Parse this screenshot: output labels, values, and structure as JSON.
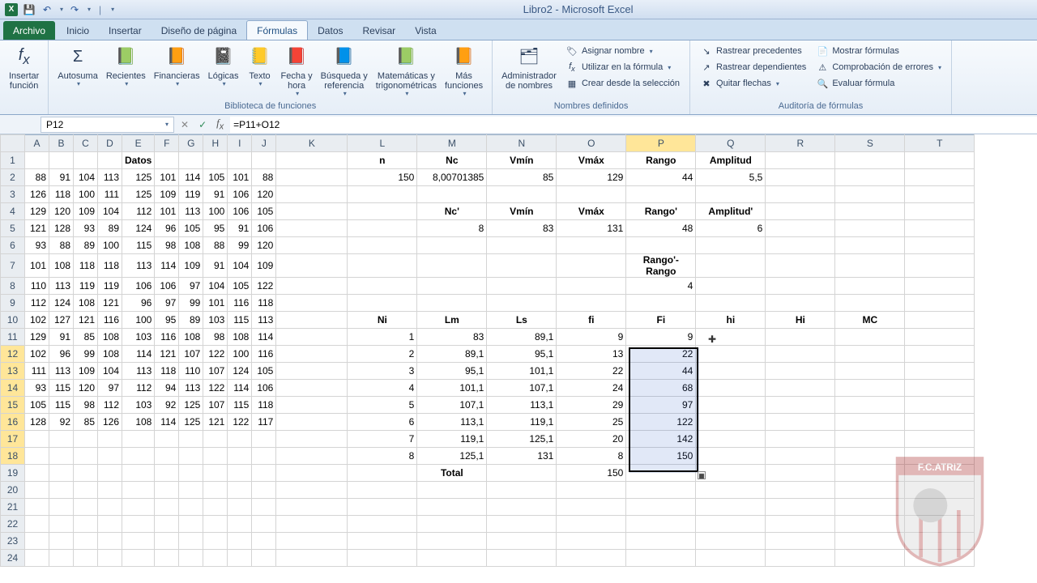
{
  "app": {
    "title": "Libro2  -  Microsoft Excel"
  },
  "qat": {
    "save": "💾",
    "undo": "↶",
    "redo": "↷"
  },
  "tabs": {
    "file": "Archivo",
    "inicio": "Inicio",
    "insertar": "Insertar",
    "diseno": "Diseño de página",
    "formulas": "Fórmulas",
    "datos": "Datos",
    "revisar": "Revisar",
    "vista": "Vista"
  },
  "ribbon": {
    "insertfn": "Insertar\nfunción",
    "autosuma": "Autosuma",
    "recientes": "Recientes",
    "financieras": "Financieras",
    "logicas": "Lógicas",
    "texto": "Texto",
    "fechahora": "Fecha y\nhora",
    "busqueda": "Búsqueda y\nreferencia",
    "mattrig": "Matemáticas y\ntrigonométricas",
    "mas": "Más\nfunciones",
    "biblioteca": "Biblioteca de funciones",
    "adminnombres": "Administrador\nde nombres",
    "asignarnombre": "Asignar nombre",
    "utilizarformula": "Utilizar en la fórmula",
    "creardesde": "Crear desde la selección",
    "nombresdef": "Nombres definidos",
    "rastrearprec": "Rastrear precedentes",
    "rastreardep": "Rastrear dependientes",
    "quitarflechas": "Quitar flechas",
    "mostrarform": "Mostrar fórmulas",
    "comperrores": "Comprobación de errores",
    "evalform": "Evaluar fórmula",
    "auditoria": "Auditoría de fórmulas"
  },
  "fbar": {
    "cellref": "P12",
    "formula": "=P11+O12"
  },
  "cols": [
    "A",
    "B",
    "C",
    "D",
    "E",
    "F",
    "G",
    "H",
    "I",
    "J",
    "K",
    "L",
    "M",
    "N",
    "O",
    "P",
    "Q",
    "R",
    "S",
    "T"
  ],
  "colHighlight": "P",
  "rowHighlight": [
    12,
    13,
    14,
    15,
    16,
    17,
    18
  ],
  "datosHeader": "Datos",
  "datos": [
    [
      88,
      91,
      104,
      113,
      125,
      101,
      114,
      105,
      101,
      88
    ],
    [
      126,
      118,
      100,
      111,
      125,
      109,
      119,
      91,
      106,
      120
    ],
    [
      129,
      120,
      109,
      104,
      112,
      101,
      113,
      100,
      106,
      105
    ],
    [
      121,
      128,
      93,
      89,
      124,
      96,
      105,
      95,
      91,
      106
    ],
    [
      93,
      88,
      89,
      100,
      115,
      98,
      108,
      88,
      99,
      120
    ],
    [
      101,
      108,
      118,
      118,
      113,
      114,
      109,
      91,
      104,
      109
    ],
    [
      110,
      113,
      119,
      119,
      106,
      106,
      97,
      104,
      105,
      122
    ],
    [
      112,
      124,
      108,
      121,
      96,
      97,
      99,
      101,
      116,
      118
    ],
    [
      102,
      127,
      121,
      116,
      100,
      95,
      89,
      103,
      115,
      113
    ],
    [
      129,
      91,
      85,
      108,
      103,
      116,
      108,
      98,
      108,
      114
    ],
    [
      102,
      96,
      99,
      108,
      114,
      121,
      107,
      122,
      100,
      116
    ],
    [
      111,
      113,
      109,
      104,
      113,
      118,
      110,
      107,
      124,
      105
    ],
    [
      93,
      115,
      120,
      97,
      112,
      94,
      113,
      122,
      114,
      106
    ],
    [
      105,
      115,
      98,
      112,
      103,
      92,
      125,
      107,
      115,
      118
    ],
    [
      128,
      92,
      85,
      126,
      108,
      114,
      125,
      121,
      122,
      117
    ]
  ],
  "summary1": {
    "h": {
      "n": "n",
      "Nc": "Nc",
      "Vmin": "Vmín",
      "Vmax": "Vmáx",
      "Rango": "Rango",
      "Amplitud": "Amplitud"
    },
    "v": {
      "n": "150",
      "Nc": "8,00701385",
      "Vmin": "85",
      "Vmax": "129",
      "Rango": "44",
      "Amplitud": "5,5"
    }
  },
  "summary2": {
    "h": {
      "Nc": "Nc'",
      "Vmin": "Vmín",
      "Vmax": "Vmáx",
      "Rango": "Rango'",
      "Amplitud": "Amplitud'"
    },
    "v": {
      "Nc": "8",
      "Vmin": "83",
      "Vmax": "131",
      "Rango": "48",
      "Amplitud": "6"
    }
  },
  "diff": {
    "label": "Rango'-Rango",
    "value": "4"
  },
  "freq": {
    "h": {
      "Ni": "Ni",
      "Lm": "Lm",
      "Ls": "Ls",
      "fi": "fi",
      "Fi": "Fi",
      "hi": "hi",
      "Hi": "Hi",
      "MC": "MC"
    },
    "rows": [
      {
        "Ni": "1",
        "Lm": "83",
        "Ls": "89,1",
        "fi": "9",
        "Fi": "9"
      },
      {
        "Ni": "2",
        "Lm": "89,1",
        "Ls": "95,1",
        "fi": "13",
        "Fi": "22"
      },
      {
        "Ni": "3",
        "Lm": "95,1",
        "Ls": "101,1",
        "fi": "22",
        "Fi": "44"
      },
      {
        "Ni": "4",
        "Lm": "101,1",
        "Ls": "107,1",
        "fi": "24",
        "Fi": "68"
      },
      {
        "Ni": "5",
        "Lm": "107,1",
        "Ls": "113,1",
        "fi": "29",
        "Fi": "97"
      },
      {
        "Ni": "6",
        "Lm": "113,1",
        "Ls": "119,1",
        "fi": "25",
        "Fi": "122"
      },
      {
        "Ni": "7",
        "Lm": "119,1",
        "Ls": "125,1",
        "fi": "20",
        "Fi": "142"
      },
      {
        "Ni": "8",
        "Lm": "125,1",
        "Ls": "131",
        "fi": "8",
        "Fi": "150"
      }
    ],
    "totalLabel": "Total",
    "totalFi": "150"
  }
}
